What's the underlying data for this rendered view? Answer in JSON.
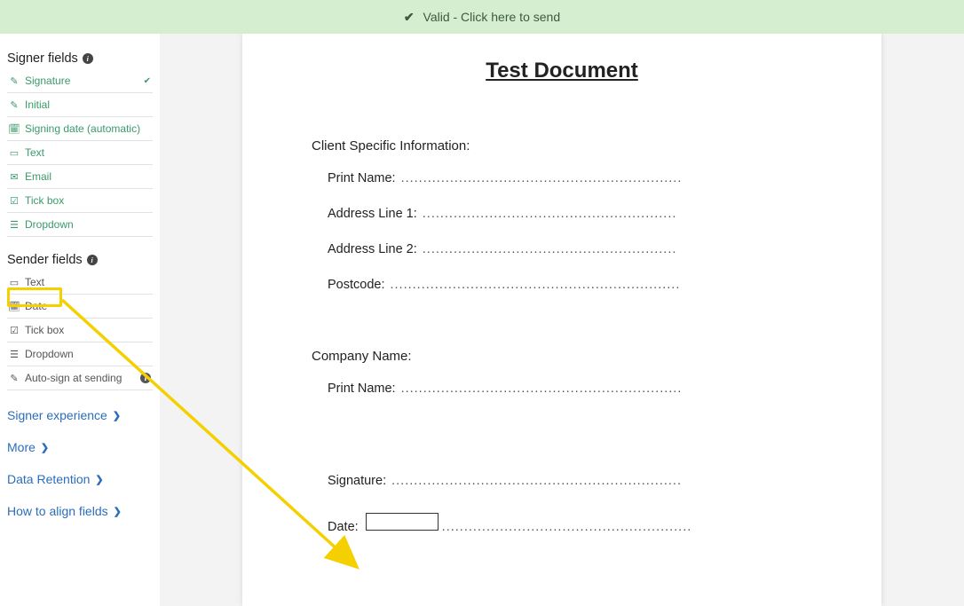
{
  "banner": {
    "text": "Valid - Click here to send"
  },
  "sidebar": {
    "signer_heading": "Signer fields",
    "sender_heading": "Sender fields",
    "signer_fields": [
      {
        "label": "Signature",
        "icon": "pencil-square",
        "trailing": "check"
      },
      {
        "label": "Initial",
        "icon": "pencil"
      },
      {
        "label": "Signing date (automatic)",
        "icon": "calendar"
      },
      {
        "label": "Text",
        "icon": "text-box"
      },
      {
        "label": "Email",
        "icon": "mail"
      },
      {
        "label": "Tick box",
        "icon": "checkbox"
      },
      {
        "label": "Dropdown",
        "icon": "list"
      }
    ],
    "sender_fields": [
      {
        "label": "Text",
        "icon": "text-box"
      },
      {
        "label": "Date",
        "icon": "calendar"
      },
      {
        "label": "Tick box",
        "icon": "checkbox"
      },
      {
        "label": "Dropdown",
        "icon": "list"
      },
      {
        "label": "Auto-sign at sending",
        "icon": "pencil-square",
        "info": true
      }
    ],
    "nav_links": [
      "Signer experience",
      "More",
      "Data Retention",
      "How to align fields"
    ]
  },
  "document": {
    "title": "Test Document",
    "section1_heading": "Client Specific Information:",
    "section1_lines": [
      "Print Name:",
      "Address Line 1:",
      "Address Line 2:",
      "Postcode:"
    ],
    "section2_heading": "Company Name:",
    "section2_lines": [
      "Print Name:"
    ],
    "signature_label": "Signature:",
    "date_label": "Date:"
  },
  "annotation": {
    "highlight_target": "sender-date",
    "arrow_from": "sender-date",
    "arrow_to": "date-box"
  }
}
